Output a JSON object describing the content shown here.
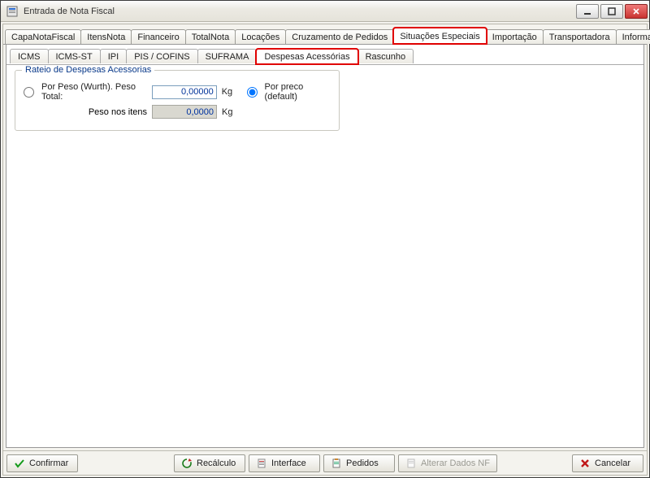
{
  "window": {
    "title": "Entrada de Nota Fiscal"
  },
  "main_tabs": {
    "items": [
      {
        "label": "CapaNotaFiscal"
      },
      {
        "label": "ItensNota"
      },
      {
        "label": "Financeiro"
      },
      {
        "label": "TotalNota"
      },
      {
        "label": "Locações"
      },
      {
        "label": "Cruzamento de Pedidos"
      },
      {
        "label": "Situações Especiais"
      },
      {
        "label": "Importação"
      },
      {
        "label": "Transportadora"
      },
      {
        "label": "Informações Adicionais"
      }
    ],
    "active_index": 6,
    "highlight_index": 6
  },
  "sub_tabs": {
    "items": [
      {
        "label": "ICMS"
      },
      {
        "label": "ICMS-ST"
      },
      {
        "label": "IPI"
      },
      {
        "label": "PIS / COFINS"
      },
      {
        "label": "SUFRAMA"
      },
      {
        "label": "Despesas Acessórias"
      },
      {
        "label": "Rascunho"
      }
    ],
    "active_index": 5,
    "highlight_index": 5
  },
  "group": {
    "title": "Rateio de Despesas Acessorias",
    "radio_peso_label": "Por Peso (Wurth). Peso Total:",
    "peso_total_value": "0,00000",
    "peso_total_unit": "Kg",
    "peso_itens_label": "Peso nos itens",
    "peso_itens_value": "0,0000",
    "peso_itens_unit": "Kg",
    "radio_preco_label": "Por preco (default)",
    "selected_radio": "preco"
  },
  "buttons": {
    "confirmar": "Confirmar",
    "recalculo": "Recálculo",
    "interface": "Interface",
    "pedidos": "Pedidos",
    "alterar": "Alterar Dados NF",
    "cancelar": "Cancelar"
  }
}
